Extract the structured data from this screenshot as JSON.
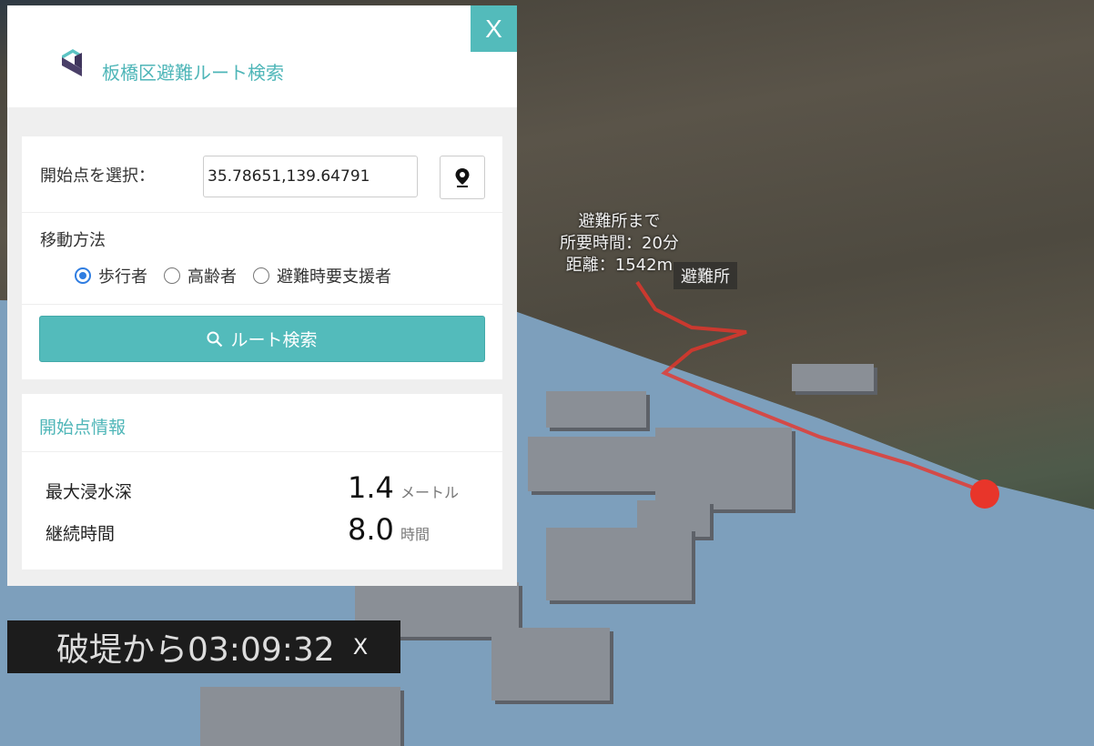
{
  "panel": {
    "title": "板橋区避難ルート検索",
    "close_label": "X",
    "start_label": "開始点を選択：",
    "start_value": "35.78651,139.64791",
    "mode_label": "移動方法",
    "modes": [
      {
        "label": "歩行者",
        "selected": true
      },
      {
        "label": "高齢者",
        "selected": false
      },
      {
        "label": "避難時要支援者",
        "selected": false
      }
    ],
    "search_label": "ルート検索",
    "info_title": "開始点情報",
    "info": [
      {
        "key": "最大浸水深",
        "value": "1.4",
        "unit": "メートル"
      },
      {
        "key": "継続時間",
        "value": "8.0",
        "unit": "時間"
      }
    ]
  },
  "map": {
    "route_lines": [
      "避難所まで",
      "所要時間：20分",
      "距離：1542m"
    ],
    "dest_label": "避難所",
    "route_color": "#e8352a",
    "flood_color": "#7d9fbc"
  },
  "timer": {
    "text": "破堤から03:09:32",
    "close_label": "X"
  }
}
